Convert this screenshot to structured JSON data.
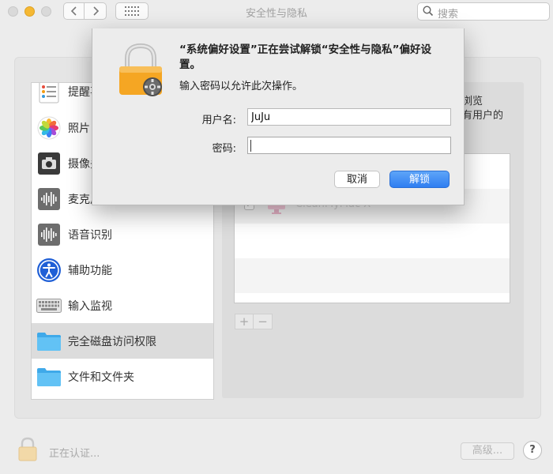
{
  "window": {
    "title": "安全性与隐私",
    "search_placeholder": "搜索"
  },
  "icons": {
    "back": "chevron-left-icon",
    "forward": "chevron-right-icon",
    "grid": "grid-icon",
    "search": "search-icon",
    "lock": "lock-icon",
    "help": "?"
  },
  "sidebar": {
    "items": [
      {
        "label": "提醒事项",
        "icon": "reminders-icon"
      },
      {
        "label": "照片",
        "icon": "photos-icon"
      },
      {
        "label": "摄像头",
        "icon": "camera-icon"
      },
      {
        "label": "麦克风",
        "icon": "microphone-icon"
      },
      {
        "label": "语音识别",
        "icon": "speech-recognition-icon"
      },
      {
        "label": "辅助功能",
        "icon": "accessibility-icon"
      },
      {
        "label": "输入监视",
        "icon": "keyboard-icon"
      },
      {
        "label": "完全磁盘访问权限",
        "icon": "folder-icon"
      },
      {
        "label": "文件和文件夹",
        "icon": "folder-icon"
      }
    ],
    "selected_index": 7
  },
  "right_panel": {
    "description_line1": "浏览",
    "description_line2": "有用户的",
    "apps": [
      {
        "name": "CleanMyMac X",
        "checked": true
      }
    ],
    "add_label": "+",
    "remove_label": "−"
  },
  "bottom": {
    "auth_status": "正在认证...",
    "advanced_label": "高级...",
    "help_label": "?"
  },
  "dialog": {
    "message": "“系统偏好设置”正在尝试解锁“安全性与隐私”偏好设置。",
    "subtitle": "输入密码以允许此次操作。",
    "username_label": "用户名:",
    "username_value": "JuJu",
    "password_label": "密码:",
    "password_value": "",
    "cancel_label": "取消",
    "unlock_label": "解锁"
  },
  "colors": {
    "accent": "#2f7ef1",
    "lock_gold": "#f5a623",
    "selected_row": "#dcdcdc"
  }
}
